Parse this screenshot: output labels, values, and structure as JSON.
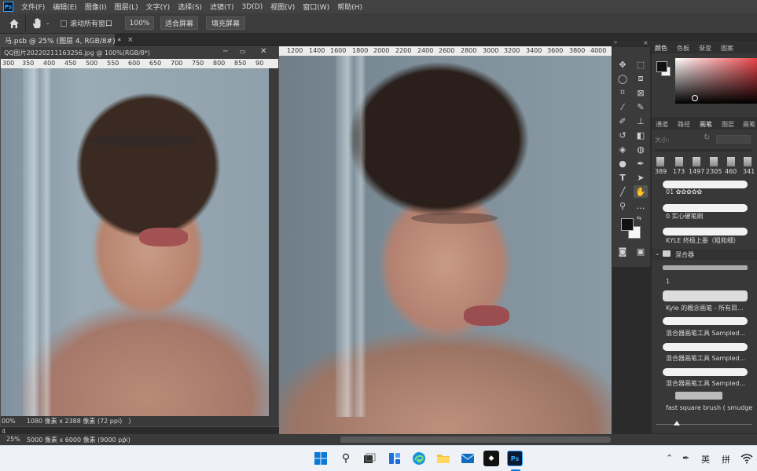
{
  "menubar": {
    "logo": "Ps",
    "items": [
      "文件(F)",
      "编辑(E)",
      "图像(I)",
      "图层(L)",
      "文字(Y)",
      "选择(S)",
      "滤镜(T)",
      "3D(D)",
      "视图(V)",
      "窗口(W)",
      "帮助(H)"
    ]
  },
  "options": {
    "scroll_all": "滚动所有窗口",
    "zoom": "100%",
    "fit_screen": "适合屏幕",
    "fill_screen": "填充屏幕"
  },
  "tabs": {
    "main_doc": "马.psb @ 25% (图层 4, RGB/8#) *",
    "close": "×"
  },
  "float_window": {
    "title": "QQ图片20220211163256.jpg @ 100%(RGB/8*)",
    "ruler": [
      "300",
      "350",
      "400",
      "450",
      "500",
      "550",
      "600",
      "650",
      "700",
      "750",
      "800",
      "850",
      "90"
    ],
    "zoom": "00%",
    "info": "1080 像素 x 2388 像素 (72 ppi)",
    "arrow": "〉"
  },
  "main_ruler": [
    "1200",
    "1400",
    "1600",
    "1800",
    "2000",
    "2200",
    "2400",
    "2600",
    "2800",
    "3000",
    "3200",
    "3400",
    "3600",
    "3800",
    "4000"
  ],
  "main_status": {
    "zoom": "25%",
    "info": "5000 像素 x 6000 像素 (9000 ppi)",
    "arrow": "〉"
  },
  "left_marker": "4",
  "color_panel": {
    "tabs": [
      "颜色",
      "色板",
      "渐变",
      "图案"
    ],
    "fg": "#111111",
    "bg": "#f5f5f5",
    "hue": "#e8444a"
  },
  "brush_panel": {
    "tabs": [
      "通道",
      "路径",
      "画笔",
      "图层",
      "画笔"
    ],
    "size_label": "大小:",
    "sizes": [
      "389",
      "173",
      "1497",
      "2305",
      "460",
      "341"
    ],
    "brushes": [
      {
        "label": "01 ✿✿✿✿✿"
      },
      {
        "label": "0 实心硬笔刷"
      },
      {
        "label": "KYLE 终极上墨（粗和细）"
      }
    ],
    "group": "混合器",
    "group_brushes": [
      {
        "label": "1"
      },
      {
        "label": "Kyle 的概念画笔 - 所有目..."
      },
      {
        "label": "混合器画笔工具 Sampled..."
      },
      {
        "label": "混合器画笔工具 Sampled..."
      },
      {
        "label": "混合器画笔工具 Sampled..."
      },
      {
        "label": "fast square brush ( smudge )"
      }
    ]
  },
  "taskbar": {
    "tray": [
      "英",
      "拼"
    ]
  }
}
